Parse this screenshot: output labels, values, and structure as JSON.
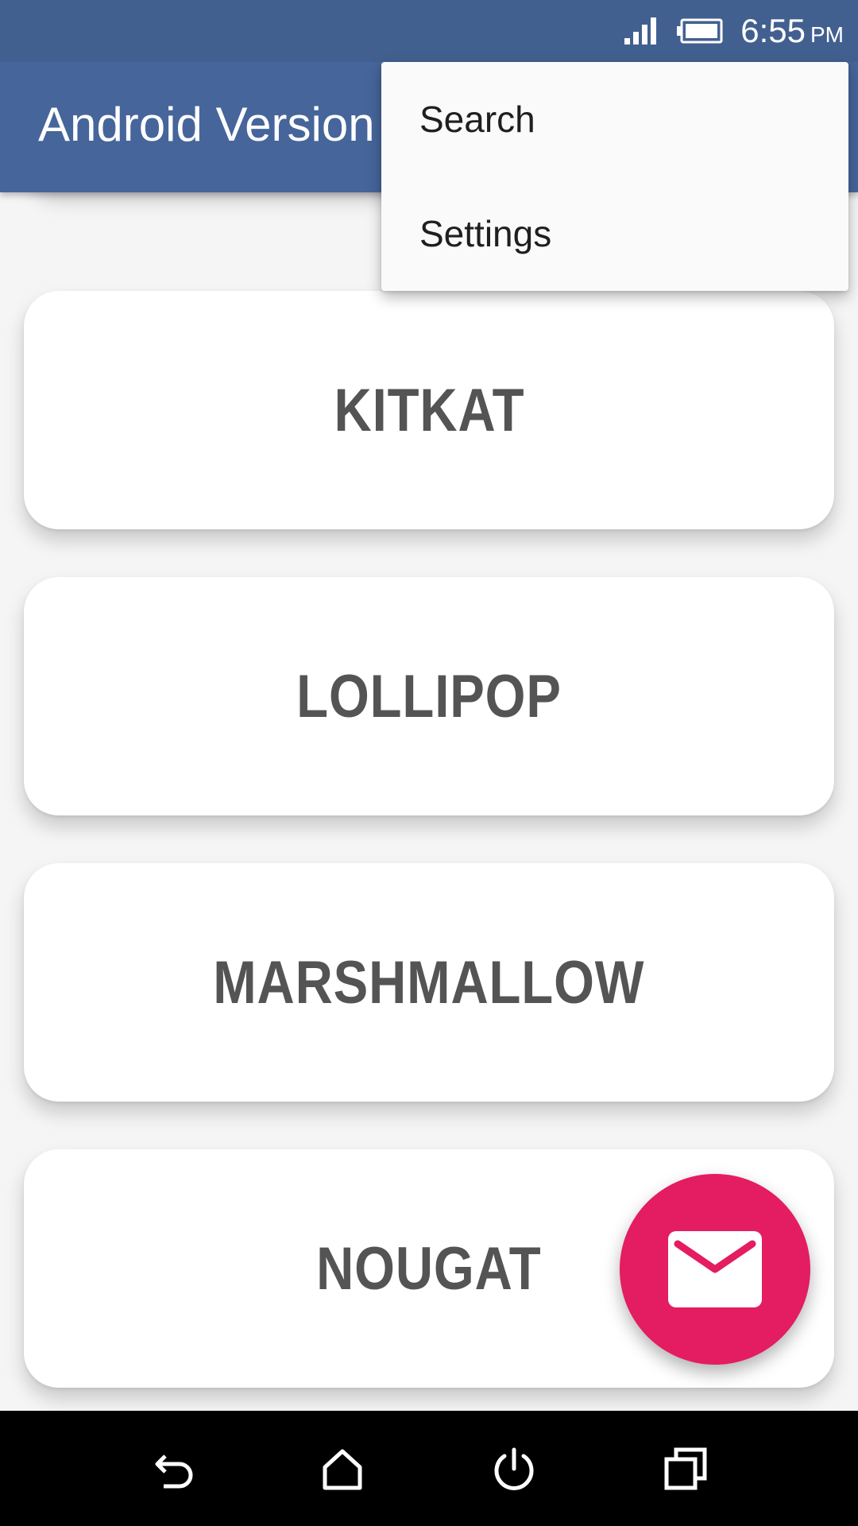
{
  "status_bar": {
    "time": "6:55",
    "ampm": "PM",
    "signal_icon": "signal-icon",
    "battery_icon": "battery-icon"
  },
  "app_bar": {
    "title": "Android Version"
  },
  "overflow_menu": {
    "items": [
      {
        "label": "Search"
      },
      {
        "label": "Settings"
      }
    ]
  },
  "list": {
    "items": [
      {
        "label": ""
      },
      {
        "label": "KITKAT"
      },
      {
        "label": "LOLLIPOP"
      },
      {
        "label": "MARSHMALLOW"
      },
      {
        "label": "NOUGAT"
      }
    ]
  },
  "fab": {
    "icon": "mail-icon",
    "color": "#e41c61"
  },
  "nav_bar": {
    "buttons": [
      "back-icon",
      "home-icon",
      "power-icon",
      "recents-icon"
    ]
  },
  "colors": {
    "app_bar": "#46659a",
    "accent": "#e41c61",
    "card_text": "#545454"
  }
}
